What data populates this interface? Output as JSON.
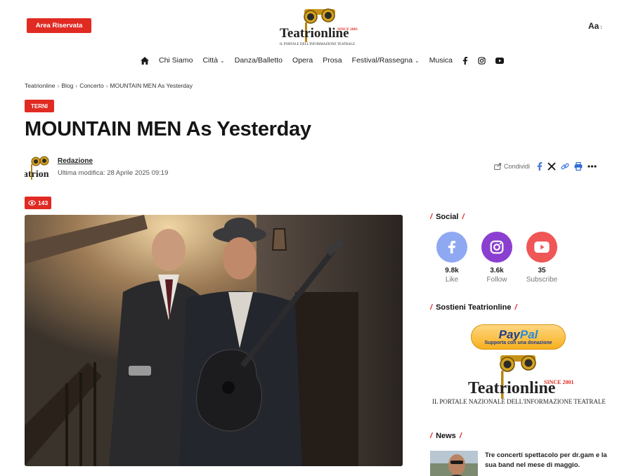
{
  "header": {
    "area_riservata": "Area Riservata",
    "logo": {
      "brand": "Teatrionline",
      "since": "SINCE 2001",
      "tagline": "IL PORTALE DELL'INFORMAZIONE TEATRALE"
    },
    "font_size_toggle": "Aa"
  },
  "nav": {
    "items": [
      {
        "label": "Chi Siamo",
        "dropdown": false
      },
      {
        "label": "Città",
        "dropdown": true
      },
      {
        "label": "Danza/Balletto",
        "dropdown": false
      },
      {
        "label": "Opera",
        "dropdown": false
      },
      {
        "label": "Prosa",
        "dropdown": false
      },
      {
        "label": "Festival/Rassegna",
        "dropdown": true
      },
      {
        "label": "Musica",
        "dropdown": false
      }
    ],
    "social_icons": [
      "facebook-icon",
      "instagram-icon",
      "youtube-icon"
    ]
  },
  "breadcrumb": [
    "Teatrionline",
    "Blog",
    "Concerto",
    "MOUNTAIN MEN As Yesterday"
  ],
  "article": {
    "category": "TERNI",
    "title": "MOUNTAIN MEN As Yesterday",
    "author": "Redazione",
    "meta": "Ultima modifica: 28 Aprile 2025 09:19",
    "views": "143",
    "share_label": "Condividi"
  },
  "sidebar": {
    "social_title": "Social",
    "social": [
      {
        "network": "facebook",
        "count": "9.8k",
        "label": "Like",
        "color": "#8fa8f2"
      },
      {
        "network": "instagram",
        "count": "3.6k",
        "label": "Follow",
        "color": "#8a3fd0"
      },
      {
        "network": "youtube",
        "count": "35",
        "label": "Subscribe",
        "color": "#f05656"
      }
    ],
    "support_title": "Sostieni Teatrionline",
    "paypal": {
      "brand_pay": "Pay",
      "brand_pal": "Pal",
      "sub": "Supporta con una donazione"
    },
    "big_logo": {
      "brand": "Teatrionline",
      "since": "SINCE 2001",
      "tagline": "IL PORTALE NAZIONALE DELL'INFORMAZIONE TEATRALE"
    },
    "news_title": "News",
    "news": [
      {
        "title": "Tre concerti spettacolo per dr.gam e la sua band nel mese di maggio."
      }
    ]
  },
  "colors": {
    "accent": "#e02a22"
  }
}
